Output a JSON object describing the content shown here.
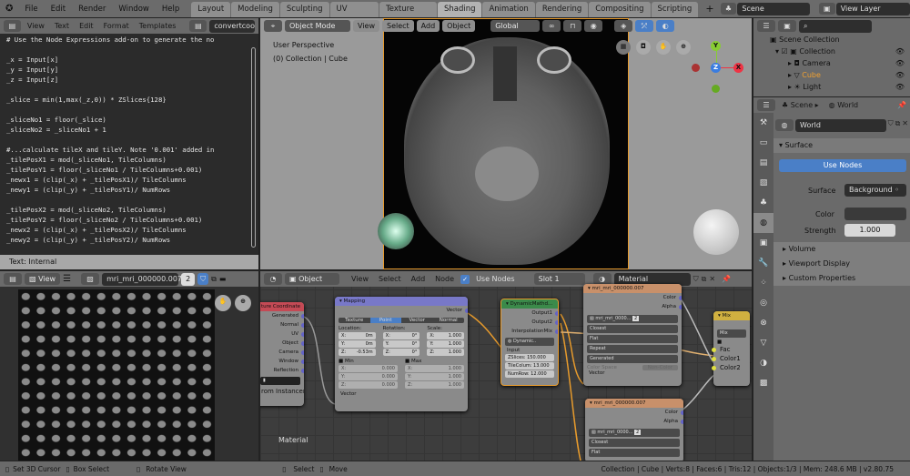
{
  "topbar": {
    "menus": [
      "File",
      "Edit",
      "Render",
      "Window",
      "Help"
    ],
    "workspaces": [
      "Layout",
      "Modeling",
      "Sculpting",
      "UV Editing",
      "Texture Paint",
      "Shading",
      "Animation",
      "Rendering",
      "Compositing",
      "Scripting"
    ],
    "active_workspace": "Shading",
    "scene": "Scene",
    "view_layer": "View Layer",
    "add_tab": "+"
  },
  "text_editor": {
    "menus": [
      "View",
      "Text",
      "Edit",
      "Format",
      "Templates"
    ],
    "file": "convertcoor",
    "lines": [
      "# Use the Node Expressions add-on to generate the no",
      "",
      "_x = Input[x]",
      "_y = Input[y]",
      "_z = Input[z]",
      "",
      "_slice = min(1,max(_z,0)) * ZSlices{128}",
      "",
      "_sliceNo1 = floor(_slice)",
      "_sliceNo2 = _sliceNo1 + 1",
      "",
      "#...calculate tileX and tileY. Note '0.001' added in",
      "_tilePosX1 = mod(_sliceNo1, TileColumns)",
      "_tilePosY1 = floor(_sliceNo1 / TileColumns+0.001)",
      "_newx1 = (clip(_x) + _tilePosX1)/ TileColumns",
      "_newy1 = (clip(_y) + _tilePosY1)/ NumRows",
      "",
      "_tilePosX2 = mod(_sliceNo2, TileColumns)",
      "_tilePosY2 = floor(_sliceNo2 / TileColumns+0.001)",
      "_newx2 = (clip(_x) + _tilePosX2)/ TileColumns",
      "_newy2 = (clip(_y) + _tilePosY2)/ NumRows"
    ],
    "footer": "Text: Internal"
  },
  "viewport": {
    "mode": "Object Mode",
    "menus": [
      "View",
      "Select",
      "Add",
      "Object"
    ],
    "orientation": "Global",
    "view_name": "User Perspective",
    "context": "(0) Collection | Cube",
    "axes": {
      "x": "X",
      "y": "Y",
      "z": "Z"
    }
  },
  "outliner": {
    "items": [
      "Scene Collection",
      "Collection",
      "Camera",
      "Cube",
      "Light"
    ]
  },
  "properties": {
    "breadcrumb": [
      "Scene",
      "World"
    ],
    "world_name": "World",
    "surface_panel": "Surface",
    "use_nodes": "Use Nodes",
    "surface_label": "Surface",
    "surface_value": "Background",
    "color_label": "Color",
    "strength_label": "Strength",
    "strength_value": "1.000",
    "panels": [
      "Volume",
      "Viewport Display",
      "Custom Properties"
    ]
  },
  "image_editor": {
    "view": "View",
    "image": "mri_mri_000000.007",
    "users": "2"
  },
  "node_editor": {
    "type": "Object",
    "menus": [
      "View",
      "Select",
      "Add",
      "Node"
    ],
    "use_nodes": "Use Nodes",
    "slot": "Slot 1",
    "material": "Material",
    "label": "Material",
    "texcoord": {
      "title": "ture Coordinate",
      "outputs": [
        "Generated",
        "Normal",
        "UV",
        "Object",
        "Camera",
        "Window",
        "Reflection"
      ],
      "extra": "rom Instancer"
    },
    "mapping": {
      "title": "Mapping",
      "out": "Vector",
      "tabs": [
        "Texture",
        "Point",
        "Vector",
        "Normal"
      ],
      "active_tab": "Point",
      "cols": [
        "Location:",
        "Rotation:",
        "Scale:"
      ],
      "loc": [
        [
          "X:",
          "0m"
        ],
        [
          "Y:",
          "0m"
        ],
        [
          "Z:",
          "-0.53m"
        ]
      ],
      "rot": [
        [
          "X:",
          "0°"
        ],
        [
          "Y:",
          "0°"
        ],
        [
          "Z:",
          "0°"
        ]
      ],
      "scale": [
        [
          "X:",
          "1.000"
        ],
        [
          "Y:",
          "1.000"
        ],
        [
          "Z:",
          "1.000"
        ]
      ],
      "min_label": "Min",
      "max_label": "Max",
      "min": [
        [
          "X:",
          "0.000"
        ],
        [
          "Y:",
          "0.000"
        ],
        [
          "Z:",
          "0.000"
        ]
      ],
      "max": [
        [
          "X:",
          "1.000"
        ],
        [
          "Y:",
          "1.000"
        ],
        [
          "Z:",
          "1.000"
        ]
      ],
      "in": "Vector"
    },
    "dyn": {
      "title": "DynamicMathd...",
      "outputs": [
        "Output1",
        "Output2",
        "InterpolationMix"
      ],
      "group": "Dynamic..",
      "in": "Input",
      "fields": [
        "ZSlices:   150.000",
        "TileColum: 13.000",
        "NumRow: 12.000"
      ]
    },
    "img1": {
      "title": "mri_mri_000000.007",
      "outputs": [
        "Color",
        "Alpha"
      ],
      "image": "mri_mri_0000...",
      "users": "2",
      "selects": [
        "Closest",
        "Flat",
        "Repeat",
        "Generated"
      ],
      "cs_label": "Color Space",
      "cs_value": "Non-Color",
      "in": "Vector"
    },
    "img2": {
      "title": "mri_mri_000000.007",
      "outputs": [
        "Color",
        "Alpha"
      ],
      "image": "mri_mri_0000...",
      "users": "2",
      "selects": [
        "Closest",
        "Flat"
      ]
    },
    "mix": {
      "title": "Mix",
      "mode": "Mix",
      "inputs": [
        "Fac",
        "Color1",
        "Color2"
      ]
    }
  },
  "status": {
    "left": [
      "Set 3D Cursor",
      "Box Select",
      "Rotate View",
      "Select",
      "Move"
    ],
    "info": "Collection | Cube | Verts:8 | Faces:6 | Tris:12 | Objects:1/3 | Mem: 248.6 MB | v2.80.75"
  }
}
